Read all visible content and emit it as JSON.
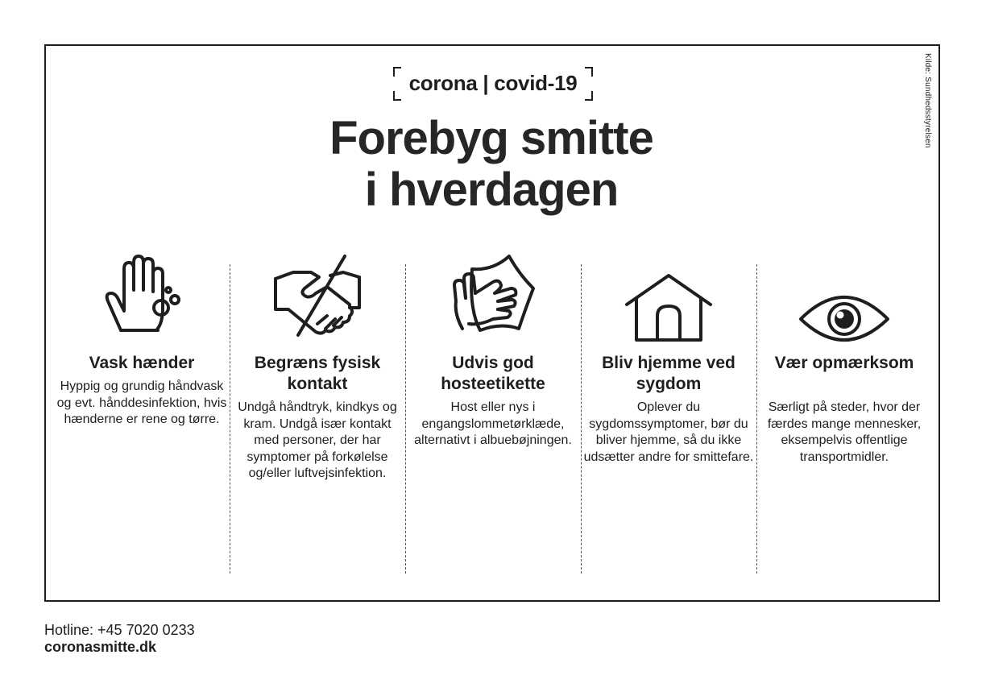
{
  "source": "Kilde: Sundhedsstyrelsen",
  "brand": "corona | covid-19",
  "title_line1": "Forebyg smitte",
  "title_line2": "i hverdagen",
  "columns": [
    {
      "icon": "hand-wash-icon",
      "title": "Vask hænder",
      "text": "Hyppig og grundig håndvask og evt. hånddesinfektion, hvis hænderne er rene og tørre."
    },
    {
      "icon": "no-handshake-icon",
      "title": "Begræns fysisk kontakt",
      "text": "Undgå håndtryk, kindkys og kram. Undgå især kontakt med personer, der har symptomer på forkølelse og/eller luftvejsinfektion."
    },
    {
      "icon": "tissue-hand-icon",
      "title": "Udvis god hosteetikette",
      "text": "Host eller nys i engangslommetørklæde, alternativt i albuebøjningen."
    },
    {
      "icon": "house-icon",
      "title": "Bliv hjemme ved sygdom",
      "text": "Oplever du sygdomssymptomer, bør du bliver hjemme, så du ikke udsætter andre for smittefare."
    },
    {
      "icon": "eye-icon",
      "title": "Vær opmærksom",
      "text": "Særligt på steder, hvor der færdes mange mennesker, eksempelvis offentlige transportmidler."
    }
  ],
  "footer": {
    "hotline": "Hotline: +45 7020 0233",
    "website": "coronasmitte.dk"
  }
}
